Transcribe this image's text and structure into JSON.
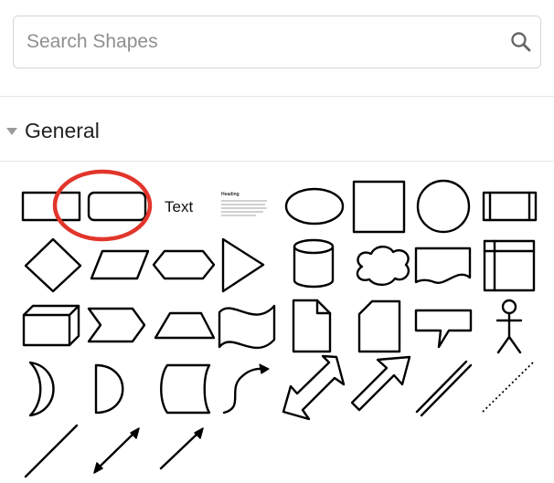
{
  "search": {
    "placeholder": "Search Shapes",
    "icon": "magnifier"
  },
  "section": {
    "title": "General",
    "expanded": true
  },
  "shapes": {
    "text_label": "Text",
    "heading_title": "Heading"
  },
  "highlight": {
    "color": "#e2352b",
    "target": "rounded-rectangle-shape"
  }
}
